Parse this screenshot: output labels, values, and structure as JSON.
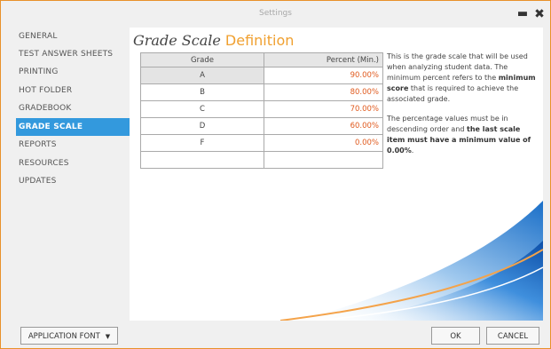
{
  "window": {
    "title": "Settings",
    "minimize_glyph": "▬",
    "close_glyph": "✖"
  },
  "sidebar": {
    "items": [
      {
        "label": "GENERAL"
      },
      {
        "label": "TEST ANSWER SHEETS"
      },
      {
        "label": "PRINTING"
      },
      {
        "label": "HOT FOLDER"
      },
      {
        "label": "GRADEBOOK"
      },
      {
        "label": "GRADE SCALE",
        "active": true
      },
      {
        "label": "REPORTS"
      },
      {
        "label": "RESOURCES"
      },
      {
        "label": "UPDATES"
      }
    ]
  },
  "main": {
    "heading_part1": "Grade Scale",
    "heading_part2": "Definition",
    "table": {
      "headers": [
        "Grade",
        "Percent (Min.)"
      ],
      "rows": [
        {
          "grade": "A",
          "percent": "90.00%"
        },
        {
          "grade": "B",
          "percent": "80.00%"
        },
        {
          "grade": "C",
          "percent": "70.00%"
        },
        {
          "grade": "D",
          "percent": "60.00%"
        },
        {
          "grade": "F",
          "percent": "0.00%"
        },
        {
          "grade": "",
          "percent": ""
        }
      ]
    },
    "description": {
      "p1_a": "This is the grade scale that will be used when analyzing student data. The minimum percent refers to the ",
      "p1_b": "minimum score",
      "p1_c": " that is required to achieve the associated grade.",
      "p2_a": "The percentage values must be in descending order and ",
      "p2_b": "the last scale item must have a minimum value of 0.00%",
      "p2_c": "."
    }
  },
  "footer": {
    "font_button": "APPLICATION FONT",
    "font_caret": "▼",
    "ok": "OK",
    "cancel": "CANCEL"
  },
  "colors": {
    "accent": "#3399dd",
    "heading_accent": "#f0a030",
    "percent_text": "#e05a1e",
    "window_border": "#e8912a"
  }
}
